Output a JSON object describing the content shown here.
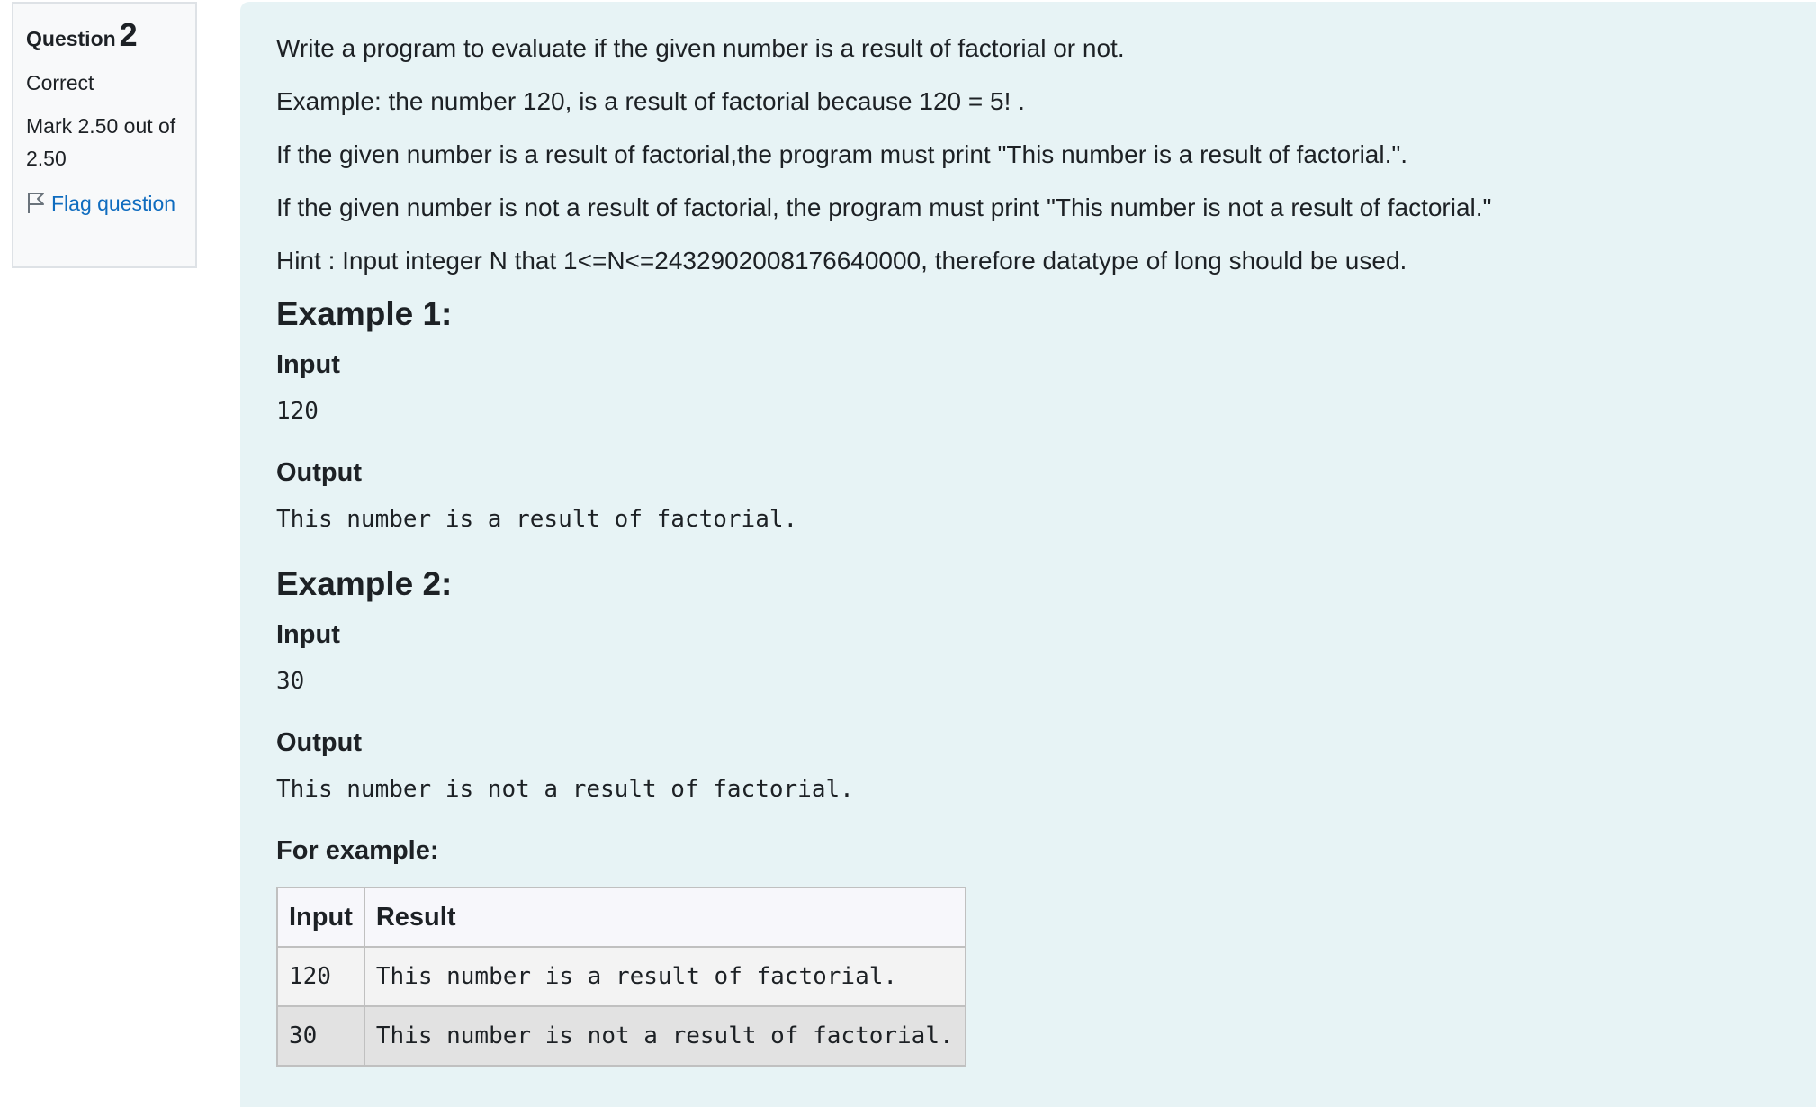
{
  "info": {
    "question_label": "Question",
    "question_number": "2",
    "state": "Correct",
    "grade": "Mark 2.50 out of 2.50",
    "flag_label": "Flag question"
  },
  "question": {
    "paragraphs": [
      "Write a program to evaluate if the given number is a result of factorial or not.",
      "Example: the number 120, is a result of factorial because 120 = 5! .",
      "If the given number is a result of factorial,the program must print \"This number is a result of factorial.\".",
      "If the given number is not a result of factorial, the program must print \"This number is not a result of factorial.\"",
      "Hint : Input integer N that 1<=N<=2432902008176640000, therefore datatype of long should be used."
    ],
    "example1": {
      "title": "Example 1:",
      "input_label": "Input",
      "input_value": "120",
      "output_label": "Output",
      "output_value": "This number is a result of factorial."
    },
    "example2": {
      "title": "Example 2:",
      "input_label": "Input",
      "input_value": "30",
      "output_label": "Output",
      "output_value": "This number is not a result of factorial."
    },
    "for_example_label": "For example:",
    "table": {
      "headers": [
        "Input",
        "Result"
      ],
      "rows": [
        [
          "120",
          "This number is a result of factorial."
        ],
        [
          "30",
          "This number is not a result of factorial."
        ]
      ]
    }
  },
  "colors": {
    "formulation_bg": "#e7f3f5",
    "link": "#0f6cbf",
    "info_bg": "#f8f9fa"
  }
}
